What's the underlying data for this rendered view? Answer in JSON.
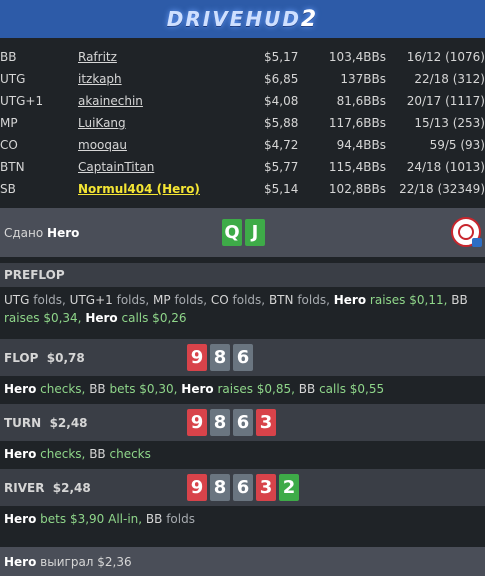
{
  "app": {
    "logo_text": "DRIVEHUD",
    "logo_version": "2"
  },
  "players": [
    {
      "pos": "BB",
      "name": "Rafritz",
      "stack": "$5,17",
      "bbs": "103,4BBs",
      "stats": "16/12 (1076)"
    },
    {
      "pos": "UTG",
      "name": "itzkaph",
      "stack": "$6,85",
      "bbs": "137BBs",
      "stats": "22/18 (312)"
    },
    {
      "pos": "UTG+1",
      "name": "akainechin",
      "stack": "$4,08",
      "bbs": "81,6BBs",
      "stats": "20/17 (1117)"
    },
    {
      "pos": "MP",
      "name": "LuiKang",
      "stack": "$5,88",
      "bbs": "117,6BBs",
      "stats": "15/13 (253)"
    },
    {
      "pos": "CO",
      "name": "mooqau",
      "stack": "$4,72",
      "bbs": "94,4BBs",
      "stats": "59/5 (93)"
    },
    {
      "pos": "BTN",
      "name": "CaptainTitan",
      "stack": "$5,77",
      "bbs": "115,4BBs",
      "stats": "24/18 (1013)"
    },
    {
      "pos": "SB",
      "name": "Normul404 (Hero)",
      "stack": "$5,14",
      "bbs": "102,8BBs",
      "stats": "22/18 (32349)"
    }
  ],
  "dealt": {
    "label": "Сдано",
    "hero": "Hero",
    "cards": [
      "Q",
      "J"
    ]
  },
  "preflop": {
    "title": "PREFLOP",
    "a1_p": "UTG",
    "a1_v": "folds,",
    "a2_p": "UTG+1",
    "a2_v": "folds,",
    "a3_p": "MP",
    "a3_v": "folds,",
    "a4_p": "CO",
    "a4_v": "folds,",
    "a5_p": "BTN",
    "a5_v": "folds,",
    "a6_p": "Hero",
    "a6_v": "raises $0,11,",
    "a7_p": "BB",
    "a7_v": "raises $0,34,",
    "a8_p": "Hero",
    "a8_v": "calls $0,26"
  },
  "flop": {
    "title": "FLOP",
    "pot": "$0,78",
    "cards": [
      "9",
      "8",
      "6"
    ],
    "a1_p": "Hero",
    "a1_v": "checks,",
    "a2_p": "BB",
    "a2_v": "bets $0,30,",
    "a3_p": "Hero",
    "a3_v": "raises $0,85,",
    "a4_p": "BB",
    "a4_v": "calls $0,55"
  },
  "turn": {
    "title": "TURN",
    "pot": "$2,48",
    "cards": [
      "9",
      "8",
      "6",
      "3"
    ],
    "a1_p": "Hero",
    "a1_v": "checks,",
    "a2_p": "BB",
    "a2_v": "checks"
  },
  "river": {
    "title": "RIVER",
    "pot": "$2,48",
    "cards": [
      "9",
      "8",
      "6",
      "3",
      "2"
    ],
    "a1_p": "Hero",
    "a1_v": "bets $3,90 All-in,",
    "a2_p": "BB",
    "a2_v": "folds"
  },
  "result": {
    "hero": "Hero",
    "text": "выиграл $2,36"
  },
  "colors": {
    "header": "#2d5ba8",
    "hero_name": "#f5e634",
    "card_red": "#d8434a",
    "card_gray": "#6a7580",
    "card_green": "#3eab48",
    "action_green": "#8fd68a"
  }
}
